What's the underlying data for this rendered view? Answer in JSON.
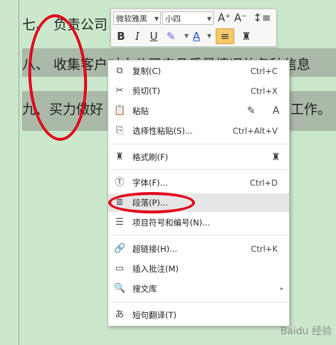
{
  "document": {
    "lines": [
      "七、 负责公司",
      "八、 收集客户对本公司产品质量情况的各种信息",
      "九、买力做好",
      "工作。"
    ]
  },
  "toolbar": {
    "font_name": "微软雅黑",
    "font_size": "小四",
    "grow_font": "A⁺",
    "shrink_font": "A⁻",
    "line_spacing": "↕≡",
    "bold": "B",
    "italic": "I",
    "underline": "U",
    "highlight": "✎",
    "font_color": "A",
    "align": "≡",
    "format_painter": "♜"
  },
  "menu": {
    "items": [
      {
        "label": "复制(C)",
        "shortcut": "Ctrl+C",
        "icon": "copy-icon",
        "glyph": "⧉"
      },
      {
        "label": "剪切(T)",
        "shortcut": "Ctrl+X",
        "icon": "cut-icon",
        "glyph": "✂"
      },
      {
        "label": "粘贴",
        "shortcut": "",
        "icon": "paste-icon",
        "glyph": "📋"
      },
      {
        "label": "选择性粘贴(S)...",
        "shortcut": "Ctrl+Alt+V",
        "icon": "paste-special-icon",
        "glyph": "⎘"
      },
      {
        "label": "格式刷(F)",
        "shortcut": "",
        "icon": "format-painter-icon",
        "glyph": "♜"
      },
      {
        "label": "字体(F)...",
        "shortcut": "Ctrl+D",
        "icon": "font-icon",
        "glyph": "Ⓣ"
      },
      {
        "label": "段落(P)...",
        "shortcut": "",
        "icon": "paragraph-icon",
        "glyph": "≣"
      },
      {
        "label": "项目符号和编号(N)...",
        "shortcut": "",
        "icon": "bullets-icon",
        "glyph": "☰"
      },
      {
        "label": "超链接(H)...",
        "shortcut": "Ctrl+K",
        "icon": "hyperlink-icon",
        "glyph": "🔗"
      },
      {
        "label": "插入批注(M)",
        "shortcut": "",
        "icon": "comment-icon",
        "glyph": "▭"
      },
      {
        "label": "搜文库",
        "shortcut": "",
        "icon": "search-library-icon",
        "glyph": "🔍"
      },
      {
        "label": "短句翻译(T)",
        "shortcut": "",
        "icon": "translate-icon",
        "glyph": "あ"
      }
    ],
    "paste_options_glyphs": [
      "✎",
      "A"
    ],
    "format_painter_side_glyph": "♜"
  },
  "watermark": "Baidu 经验"
}
